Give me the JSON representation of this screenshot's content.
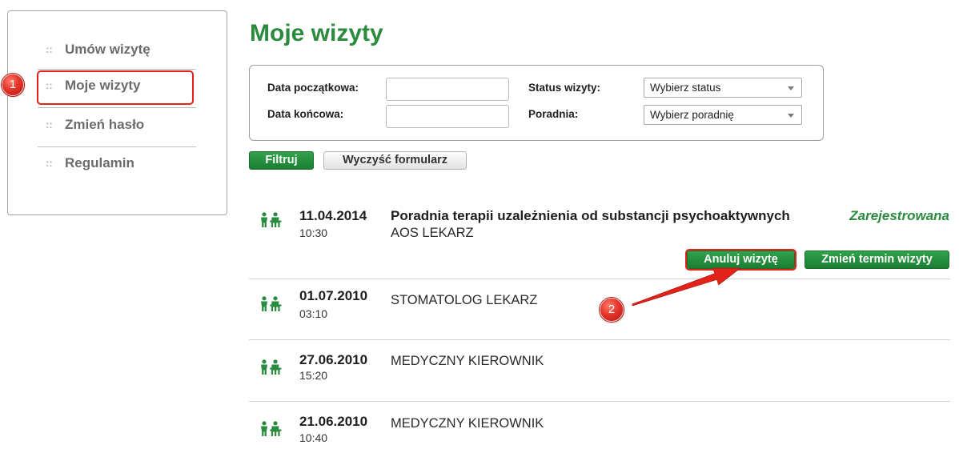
{
  "sidebar": {
    "bullet": "::",
    "items": [
      {
        "label": "Umów wizytę"
      },
      {
        "label": "Moje wizyty"
      },
      {
        "label": "Zmień hasło"
      },
      {
        "label": "Regulamin"
      }
    ]
  },
  "page_title": "Moje wizyty",
  "filters": {
    "start_date": {
      "label": "Data początkowa:",
      "value": ""
    },
    "end_date": {
      "label": "Data końcowa:",
      "value": ""
    },
    "status": {
      "label": "Status wizyty:",
      "selected": "Wybierz status"
    },
    "clinic": {
      "label": "Poradnia:",
      "selected": "Wybierz poradnię"
    },
    "filter_button": "Filtruj",
    "clear_button": "Wyczyść formularz"
  },
  "visits": [
    {
      "date": "11.04.2014",
      "time": "10:30",
      "clinic": "Poradnia terapii uzależnienia od substancji psychoaktywnych",
      "doctor": "AOS LEKARZ",
      "status": "Zarejestrowana",
      "actions": {
        "cancel": "Anuluj wizytę",
        "reschedule": "Zmień termin wizyty"
      }
    },
    {
      "date": "01.07.2010",
      "time": "03:10",
      "doctor": "STOMATOLOG LEKARZ"
    },
    {
      "date": "27.06.2010",
      "time": "15:20",
      "doctor": "MEDYCZNY KIEROWNIK"
    },
    {
      "date": "21.06.2010",
      "time": "10:40",
      "doctor": "MEDYCZNY KIEROWNIK"
    }
  ],
  "annotations": {
    "badge_1": "1",
    "badge_2": "2"
  },
  "icons": {
    "visit": "people-icon",
    "select": "chevron-down-icon"
  },
  "colors": {
    "green": "#2a8a3e",
    "annotation_red": "#e2231a"
  }
}
